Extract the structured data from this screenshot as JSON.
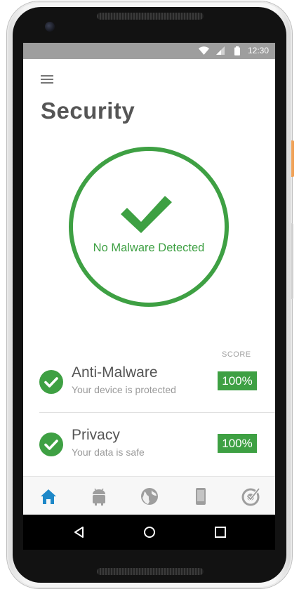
{
  "statusbar": {
    "time": "12:30",
    "icons": [
      "wifi-icon",
      "signal-icon",
      "battery-icon"
    ]
  },
  "header": {
    "menu_icon": "hamburger-menu-icon",
    "title": "Security"
  },
  "status_ring": {
    "label": "No Malware Detected",
    "icon": "checkmark-icon",
    "color": "#3ea043"
  },
  "score_column_label": "SCORE",
  "items": [
    {
      "title": "Anti-Malware",
      "subtitle": "Your device is protected",
      "score": "100%"
    },
    {
      "title": "Privacy",
      "subtitle": "Your data is safe",
      "score": "100%"
    }
  ],
  "bottom_nav": {
    "items": [
      "home-icon",
      "android-icon",
      "globe-icon",
      "phone-icon",
      "check-target-icon"
    ],
    "active_index": 0,
    "active_color": "#1e88c8"
  },
  "system_nav": [
    "back-icon",
    "home-circle-icon",
    "recents-icon"
  ],
  "colors": {
    "accent_green": "#3ea043",
    "title_gray": "#555555",
    "statusbar": "#9e9e9e"
  }
}
